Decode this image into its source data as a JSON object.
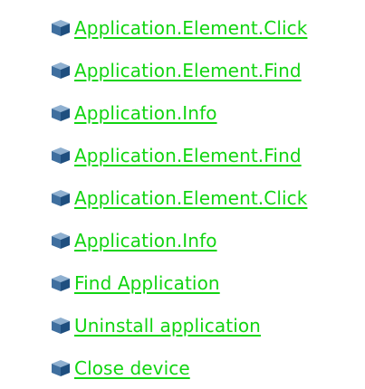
{
  "links": [
    {
      "label": "Application.Element.Click",
      "icon": "cube-icon"
    },
    {
      "label": "Application.Element.Find",
      "icon": "cube-icon"
    },
    {
      "label": "Application.Info",
      "icon": "cube-icon"
    },
    {
      "label": "Application.Element.Find",
      "icon": "cube-icon"
    },
    {
      "label": "Application.Element.Click",
      "icon": "cube-icon"
    },
    {
      "label": "Application.Info",
      "icon": "cube-icon"
    },
    {
      "label": "Find Application",
      "icon": "cube-icon"
    },
    {
      "label": "Uninstall application",
      "icon": "cube-icon"
    },
    {
      "label": "Close device",
      "icon": "cube-icon"
    }
  ],
  "colors": {
    "link": "#11d411",
    "icon_top": "#8fb0d0",
    "icon_left": "#3f6f9f",
    "icon_right": "#1f4f7f"
  }
}
